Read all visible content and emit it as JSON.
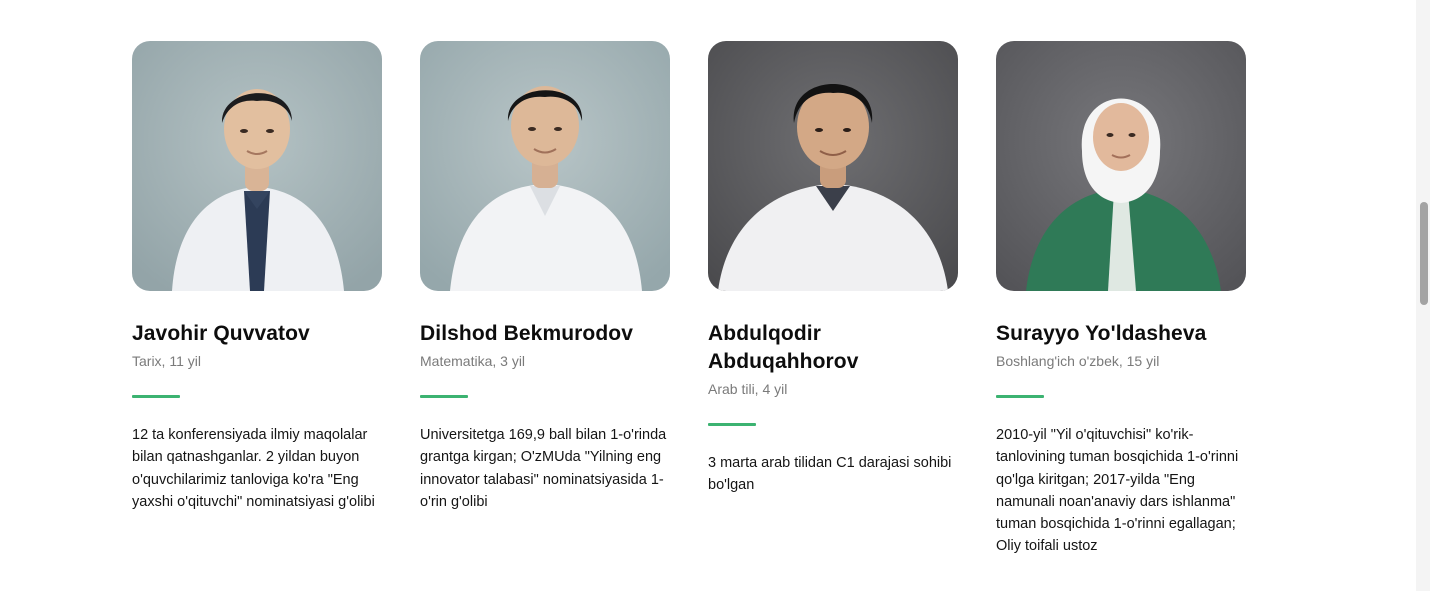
{
  "colors": {
    "accent": "#3cb371"
  },
  "teachers": [
    {
      "name": "Javohir Quvvatov",
      "meta": "Tarix, 11 yil",
      "description": "12 ta konferensiyada ilmiy maqolalar bilan qatnashganlar. 2 yildan buyon o'quvchilarimiz tanloviga ko'ra \"Eng yaxshi o'qituvchi\" nominatsiyasi g'olibi",
      "photo_icon": "teacher-photo"
    },
    {
      "name": "Dilshod Bekmurodov",
      "meta": "Matematika, 3 yil",
      "description": "Universitetga 169,9 ball bilan 1-o'rinda grantga kirgan; O'zMUda \"Yilning eng innovator talabasi\" nominatsiyasida 1-o'rin g'olibi",
      "photo_icon": "teacher-photo"
    },
    {
      "name": "Abdulqodir Abduqahhorov",
      "meta": "Arab tili, 4 yil",
      "description": "3 marta arab tilidan C1 darajasi sohibi bo'lgan",
      "photo_icon": "teacher-photo"
    },
    {
      "name": "Surayyo Yo'ldasheva",
      "meta": "Boshlang'ich o'zbek, 15 yil",
      "description": "2010-yil \"Yil o'qituvchisi\" ko'rik-tanlovining tuman bosqichida 1-o'rinni qo'lga kiritgan; 2017-yilda \"Eng namunali noan'anaviy dars ishlanma\" tuman bosqichida 1-o'rinni egallagan; Oliy toifali ustoz",
      "photo_icon": "teacher-photo"
    }
  ]
}
